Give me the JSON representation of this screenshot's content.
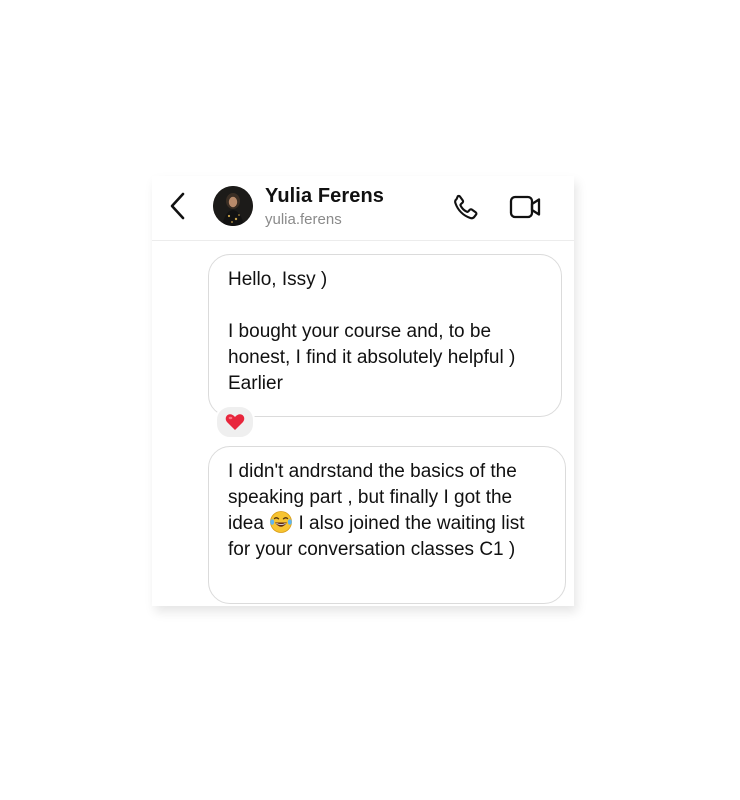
{
  "contact": {
    "name": "Yulia Ferens",
    "username": "yulia.ferens"
  },
  "header": {
    "back_icon": "chevron-left-icon",
    "call_icon": "phone-icon",
    "video_icon": "video-camera-icon"
  },
  "messages": [
    {
      "text": "Hello, Issy )\n\nI bought your course and, to be honest, I find it absolutely helpful ) Earlier",
      "reaction": "❤️"
    },
    {
      "text_before_emoji": "I didn't andrstand the basics of the speaking part , but finally I got the idea ",
      "emoji": "😂",
      "text_after_emoji": " I also joined the waiting list for your conversation classes C1 )"
    }
  ],
  "colors": {
    "bubble_border": "#dbdbdb",
    "reaction_bg": "#efefef",
    "heart": "#e8263c",
    "muted_text": "#8a8a8a"
  }
}
